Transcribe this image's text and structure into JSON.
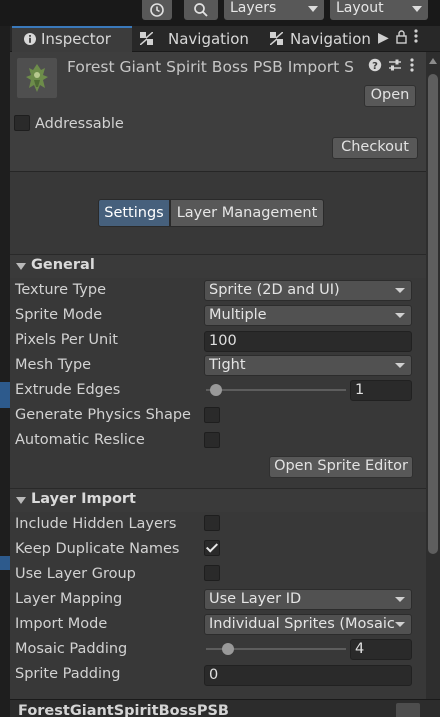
{
  "toolbar": {
    "history_icon": "history-icon",
    "search_icon": "search-icon",
    "layers_label": "Layers",
    "layout_label": "Layout"
  },
  "tabs": [
    {
      "label": "Inspector",
      "icon": "info-icon",
      "active": true
    },
    {
      "label": "Navigation",
      "icon": "navigation-icon",
      "active": false
    },
    {
      "label": "Navigation",
      "icon": "navigation-icon",
      "active": false
    }
  ],
  "inspector": {
    "title": "Forest Giant Spirit Boss PSB Import S",
    "open_label": "Open",
    "addressable_label": "Addressable",
    "addressable_checked": false,
    "checkout_label": "Checkout",
    "segments": {
      "settings": "Settings",
      "layer_management": "Layer Management",
      "selected": "Settings"
    }
  },
  "general": {
    "title": "General",
    "texture_type_label": "Texture Type",
    "texture_type_value": "Sprite (2D and UI)",
    "sprite_mode_label": "Sprite Mode",
    "sprite_mode_value": "Multiple",
    "pixels_per_unit_label": "Pixels Per Unit",
    "pixels_per_unit_value": "100",
    "mesh_type_label": "Mesh Type",
    "mesh_type_value": "Tight",
    "extrude_edges_label": "Extrude Edges",
    "extrude_edges_value": "1",
    "extrude_edges_fraction": 0.031,
    "generate_physics_label": "Generate Physics Shape",
    "generate_physics_checked": false,
    "automatic_reslice_label": "Automatic Reslice",
    "automatic_reslice_checked": false,
    "open_sprite_editor_label": "Open Sprite Editor"
  },
  "layer_import": {
    "title": "Layer Import",
    "include_hidden_label": "Include Hidden Layers",
    "include_hidden_checked": false,
    "keep_duplicate_label": "Keep Duplicate Names",
    "keep_duplicate_checked": true,
    "use_layer_group_label": "Use Layer Group",
    "use_layer_group_checked": false,
    "layer_mapping_label": "Layer Mapping",
    "layer_mapping_value": "Use Layer ID",
    "import_mode_label": "Import Mode",
    "import_mode_value": "Individual Sprites (Mosaic",
    "mosaic_padding_label": "Mosaic Padding",
    "mosaic_padding_value": "4",
    "mosaic_padding_fraction": 0.125,
    "sprite_padding_label": "Sprite Padding",
    "sprite_padding_value": "0"
  },
  "footer": {
    "asset_name": "ForestGiantSpiritBossPSB"
  },
  "colors": {
    "accent": "#3a79bb",
    "selected_segment": "#46607c",
    "panel_bg": "#383838"
  }
}
